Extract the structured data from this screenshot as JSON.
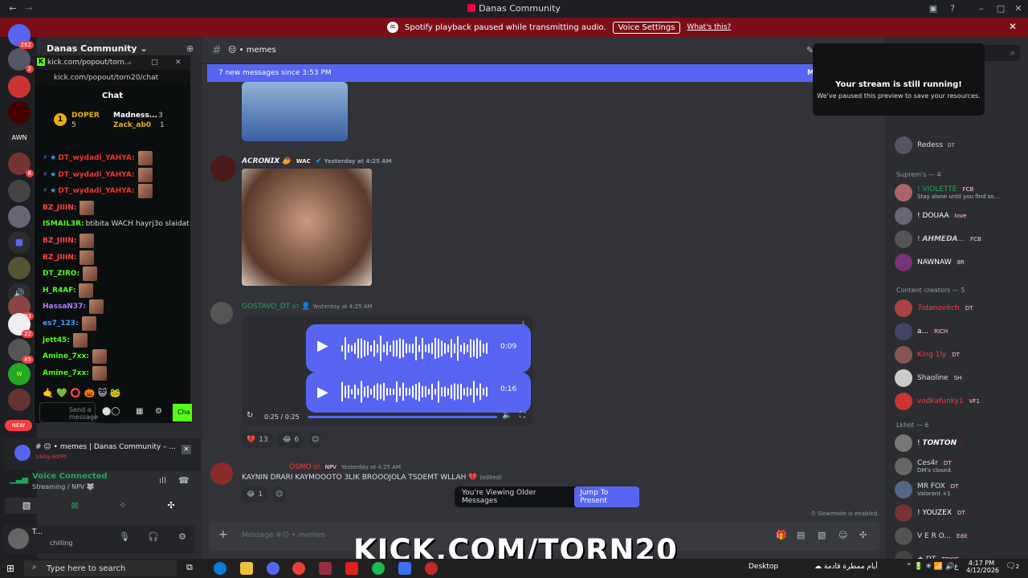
{
  "window": {
    "title": "Danas Community"
  },
  "notice": {
    "text": "Spotify playback paused while transmitting audio.",
    "button": "Voice Settings",
    "link": "What's this?"
  },
  "guilds": {
    "badges": [
      "262",
      "2",
      "8",
      "93",
      "22",
      "85"
    ],
    "new_label": "NEW",
    "awn": "AWN"
  },
  "server": {
    "name": "Danas Community"
  },
  "kick": {
    "url_short": "kick.com/popout/torn...",
    "url": "kick.com/popout/torn20/chat",
    "chat_title": "Chat",
    "pinned": [
      {
        "rank": "1",
        "name": "DOPER",
        "count": "5"
      },
      {
        "name": "Madness...",
        "count": "3"
      },
      {
        "name": "Zack_ab0",
        "count": "1"
      }
    ],
    "messages": [
      {
        "user": "DT_wydadi_YAHYA:",
        "text": ""
      },
      {
        "user": "DT_wydadi_YAHYA:",
        "text": ""
      },
      {
        "user": "DT_wydadi_YAHYA:",
        "text": ""
      },
      {
        "user": "BZ_JIIIN:",
        "text": ""
      },
      {
        "user": "ISMAIL3R:",
        "text": "btibita WACH hayrj3o slaidat"
      },
      {
        "user": "BZ_JIIIN:",
        "text": ""
      },
      {
        "user": "BZ_JIIIN:",
        "text": ""
      },
      {
        "user": "DT_ZIRO:",
        "text": ""
      },
      {
        "user": "H_R4AF:",
        "text": ""
      },
      {
        "user": "HassaN37:",
        "text": ""
      },
      {
        "user": "es7_123:",
        "text": ""
      },
      {
        "user": "jett45:",
        "text": ""
      },
      {
        "user": "Amine_7xx:",
        "text": ""
      },
      {
        "user": "Amine_7xx:",
        "text": ""
      }
    ],
    "input_placeholder": "Send a message",
    "chat_button": "Cha"
  },
  "voice_activity": {
    "title": "# 😑 • memes | Danas Community – ...",
    "quality": "1440p 60FPS"
  },
  "voice": {
    "status": "Voice Connected",
    "detail": "Streaming / NPV 🐺"
  },
  "user": {
    "name": "T...",
    "status": "chilling"
  },
  "channel": {
    "name": "memes",
    "emoji": "😑",
    "new_banner": "7 new messages since 3:53 PM",
    "mark": "M"
  },
  "messages": [
    {
      "author": "𝘼𝘾𝙍𝙊𝙉𝙄𝙓",
      "tag": "WAC",
      "time": "Yesterday at 4:25 AM"
    },
    {
      "author": "GOSTAVO_DT",
      "time": "Yesterday at 4:25 AM",
      "voice": [
        {
          "duration": "0:09"
        },
        {
          "duration": "0:16"
        }
      ],
      "player_time": "0:25 / 0:25",
      "reactions": [
        {
          "emoji": "💔",
          "count": "13"
        },
        {
          "emoji": "😂",
          "count": "6"
        }
      ]
    },
    {
      "author": "OSMO",
      "tag": "NPV",
      "time": "Yesterday at 4:25 AM",
      "text": "KAYNIN DRARI KAYMOOOTO 3LIK BROOOJOLA TSDEMT WLLAH 💔",
      "edited": "(edited)",
      "reactions": [
        {
          "emoji": "😂",
          "count": "1"
        }
      ]
    }
  ],
  "older": {
    "text": "You're Viewing Older Messages",
    "button": "Jump To Present"
  },
  "slowmode": "Slowmode is enabled.",
  "composer": {
    "placeholder": "Message #😑 • memes"
  },
  "overlay_text": "KICK.COM/TORN20",
  "stream_popup": {
    "title": "Your stream is still running!",
    "body": "We've paused this preview to save your resources."
  },
  "members": {
    "top": {
      "name": "Redess",
      "tag": "DT"
    },
    "groups": [
      {
        "label": "Suprem's — 4",
        "members": [
          {
            "name": "! VIOLETTE",
            "tag": "FCB",
            "status": "Stay alone until you find so..."
          },
          {
            "name": "! DOUAA",
            "tag": "love"
          },
          {
            "name": "! 𝘼𝙃𝙈𝙀𝘿𝘼...",
            "tag": "FCB"
          },
          {
            "name": "NAWNAW",
            "tag": "8R"
          }
        ]
      },
      {
        "label": "Content creators — 5",
        "members": [
          {
            "name": "7idanovitch",
            "tag": "DT"
          },
          {
            "name": "a...",
            "tag": "RICH"
          },
          {
            "name": "King 1ly",
            "tag": "DT"
          },
          {
            "name": "Shaoline",
            "tag": "SH"
          },
          {
            "name": "vodkafunky1",
            "tag": "VF1"
          }
        ]
      },
      {
        "label": "Lkhot — 6",
        "members": [
          {
            "name": "! 𝙏𝙊𝙉𝙏𝙊𝙉",
            "tag": ""
          },
          {
            "name": "Ces4r",
            "tag": "DT",
            "status": "DM's closed."
          },
          {
            "name": "MR FOX",
            "tag": "DT",
            "status": "Valorant +1"
          },
          {
            "name": "! YOUZEX",
            "tag": "DT"
          },
          {
            "name": "V E R O...",
            "tag": "Edit"
          },
          {
            "name": "★ DT",
            "tag": "TOXIC"
          }
        ]
      }
    ]
  },
  "taskbar": {
    "search": "Type here to search",
    "desktop": "Desktop",
    "weather": "أيام ممطرة قادمة",
    "lang": "ع",
    "time": "4:17 PM",
    "date": "4/12/2026",
    "notif": "2"
  },
  "colors": {
    "accent": "#5865f2",
    "notice_bg": "#7a0f19",
    "kick_green": "#53fc18"
  }
}
